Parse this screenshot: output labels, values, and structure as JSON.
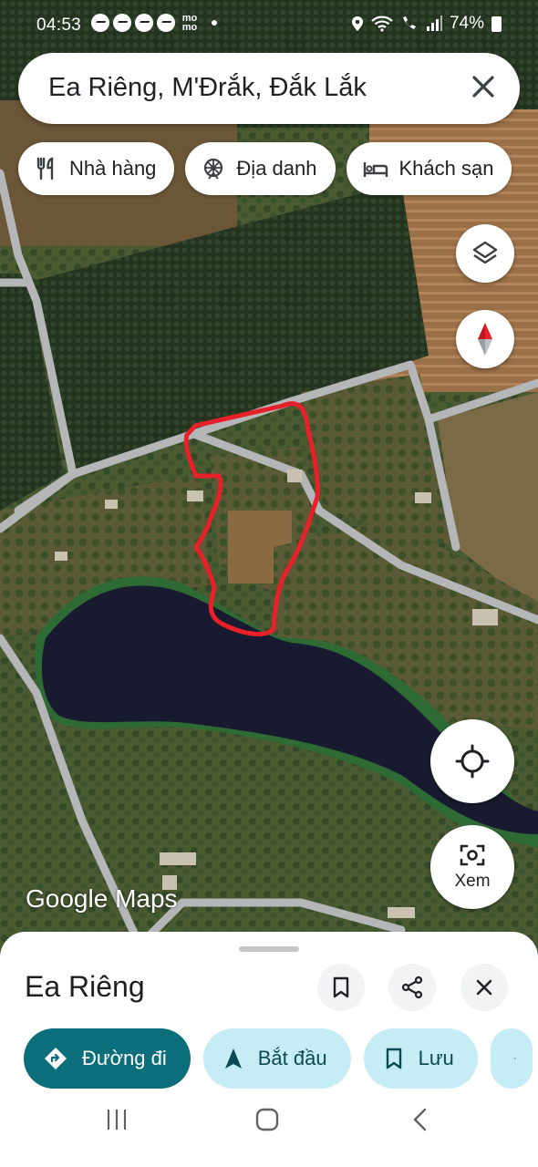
{
  "status_bar": {
    "time": "04:53",
    "notification_icons": [
      "messenger-icon",
      "messenger-icon",
      "messenger-icon",
      "messenger-icon",
      "momo-icon"
    ],
    "momo_label_top": "mo",
    "momo_label_bottom": "mo",
    "battery": "74%"
  },
  "search": {
    "query": "Ea Riêng, M'Đrắk, Đắk Lắk"
  },
  "chips": [
    {
      "label": "Nhà hàng",
      "icon": "restaurant-icon"
    },
    {
      "label": "Địa danh",
      "icon": "landmark-icon"
    },
    {
      "label": "Khách sạn",
      "icon": "hotel-icon"
    }
  ],
  "map": {
    "watermark": "Google Maps",
    "view_label": "Xem",
    "colors": {
      "marker": "#e8202a",
      "road": "#b4b6b8",
      "water": "#181b2f"
    }
  },
  "sheet": {
    "place_name": "Ea Riêng",
    "actions": [
      {
        "label": "Đường đi",
        "icon": "directions-icon",
        "style": "primary"
      },
      {
        "label": "Bắt đầu",
        "icon": "navigation-arrow-icon",
        "style": "secondary"
      },
      {
        "label": "Lưu",
        "icon": "bookmark-icon",
        "style": "secondary"
      }
    ]
  },
  "colors": {
    "accent": "#0b6e7a",
    "secondary_button": "#c6ecf5"
  }
}
